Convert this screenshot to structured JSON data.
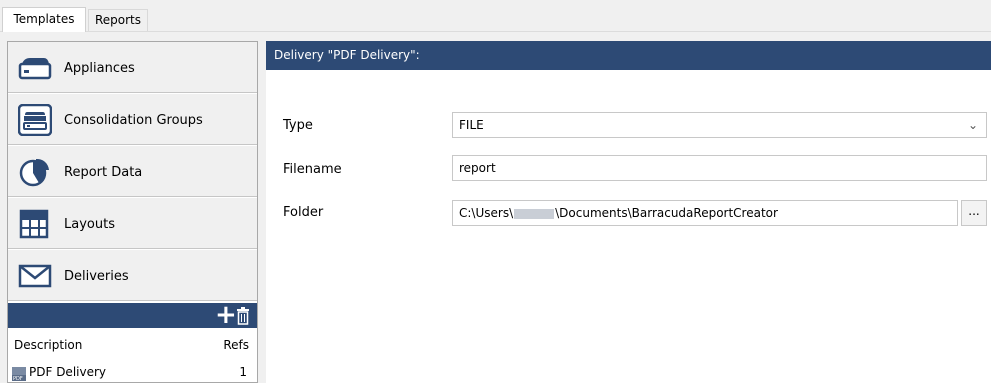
{
  "tabs": [
    {
      "label": "Templates",
      "active": true
    },
    {
      "label": "Reports",
      "active": false
    }
  ],
  "sidebar": {
    "items": [
      {
        "label": "Appliances",
        "icon": "appliance-icon"
      },
      {
        "label": "Consolidation Groups",
        "icon": "consolidation-group-icon"
      },
      {
        "label": "Report Data",
        "icon": "pie-chart-icon"
      },
      {
        "label": "Layouts",
        "icon": "grid-layout-icon"
      },
      {
        "label": "Deliveries",
        "icon": "envelope-icon"
      }
    ],
    "list": {
      "columns": [
        "Description",
        "Refs"
      ],
      "rows": [
        {
          "description": "PDF Delivery",
          "refs": "1",
          "icon": "pdf-icon"
        }
      ]
    }
  },
  "main": {
    "header": "Delivery \"PDF Delivery\":",
    "type_label": "Type",
    "type_value": "FILE",
    "filename_label": "Filename",
    "filename_value": "report",
    "folder_label": "Folder",
    "folder_prefix": "C:\\Users\\",
    "folder_suffix": "\\Documents\\BarracudaReportCreator",
    "browse_label": "..."
  },
  "colors": {
    "header_bg": "#2d4a75",
    "panel_bg": "#f0f0f0"
  }
}
